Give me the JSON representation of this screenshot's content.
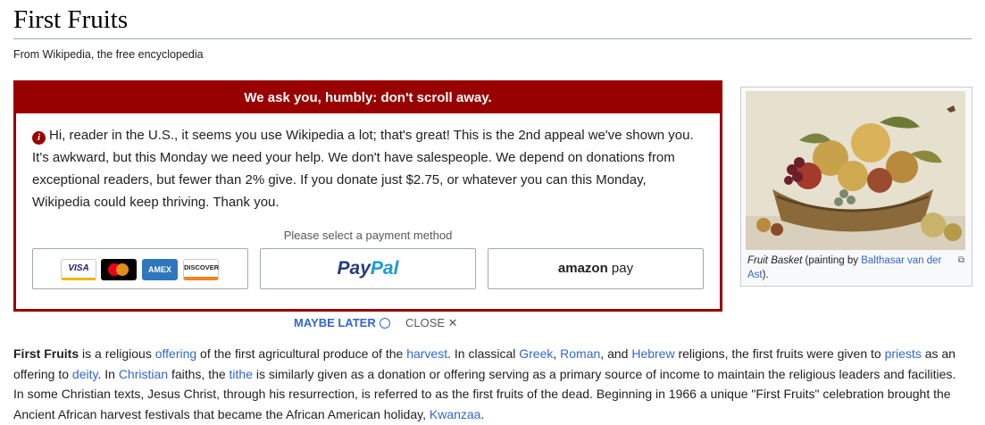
{
  "page": {
    "title": "First Fruits",
    "tagline": "From Wikipedia, the free encyclopedia"
  },
  "banner": {
    "heading": "We ask you, humbly: don't scroll away.",
    "message": "Hi, reader in the U.S., it seems you use Wikipedia a lot; that's great! This is the 2nd appeal we've shown you. It's awkward, but this Monday we need your help. We don't have salespeople. We depend on donations from exceptional readers, but fewer than 2% give. If you donate just $2.75, or whatever you can this Monday, Wikipedia could keep thriving. Thank you.",
    "payment_label": "Please select a payment method",
    "cards": {
      "visa": "VISA",
      "amex": "AMEX",
      "discover": "DISCOVER"
    },
    "paypal": {
      "part1": "Pay",
      "part2": "Pal"
    },
    "amazon": {
      "part1": "amazon",
      "part2": "pay"
    },
    "maybe_later": "MAYBE LATER",
    "close": "CLOSE ✕",
    "accent": "#990000"
  },
  "infobox": {
    "caption_italic": "Fruit Basket",
    "caption_mid": " (painting by ",
    "caption_link": "Balthasar van der Ast",
    "caption_end": ").",
    "magnify_icon": "magnify-clip-icon"
  },
  "article": {
    "p1": {
      "bold": "First Fruits",
      "t1": " is a religious ",
      "l1": "offering",
      "t2": " of the first agricultural produce of the ",
      "l2": "harvest",
      "t3": ". In classical ",
      "l3": "Greek",
      "t4": ", ",
      "l4": "Roman",
      "t5": ", and ",
      "l5": "Hebrew",
      "t6": " religions, the first fruits were given to ",
      "l6": "priests",
      "t7": " as an offering to ",
      "l7": "deity",
      "t8": ". In ",
      "l8": "Christian",
      "t9": " faiths, the ",
      "l9": "tithe",
      "t10": " is similarly given as a donation or offering serving as a primary source of income to maintain the religious leaders and facilities. In some Christian texts, Jesus Christ, through his resurrection, is referred to as the first fruits of the dead. Beginning in 1966 a unique \"First Fruits\" celebration brought the Ancient African harvest festivals that became the African American holiday, ",
      "l10": "Kwanzaa",
      "t11": "."
    }
  }
}
